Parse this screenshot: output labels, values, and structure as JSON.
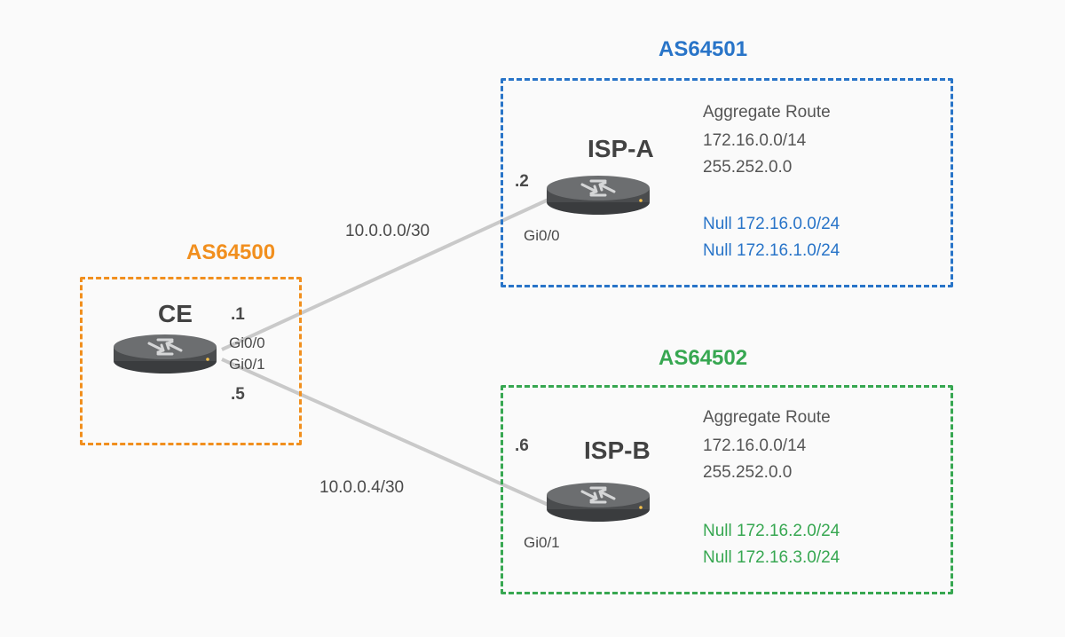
{
  "as": {
    "ce": {
      "title": "AS64500",
      "router_name": "CE",
      "ip1": ".1",
      "iface1": "Gi0/0",
      "iface2": "Gi0/1",
      "ip2": ".5"
    },
    "ispa": {
      "title": "AS64501",
      "router_name": "ISP-A",
      "ip": ".2",
      "iface": "Gi0/0",
      "agg_title": "Aggregate Route",
      "agg_net": "172.16.0.0/14",
      "agg_mask": "255.252.0.0",
      "null1": "Null 172.16.0.0/24",
      "null2": "Null 172.16.1.0/24"
    },
    "ispb": {
      "title": "AS64502",
      "router_name": "ISP-B",
      "ip": ".6",
      "iface": "Gi0/1",
      "agg_title": "Aggregate Route",
      "agg_net": "172.16.0.0/14",
      "agg_mask": "255.252.0.0",
      "null1": "Null 172.16.2.0/24",
      "null2": "Null 172.16.3.0/24"
    }
  },
  "links": {
    "a": "10.0.0.0/30",
    "b": "10.0.0.4/30"
  },
  "colors": {
    "orange": "#f18f1e",
    "blue": "#2874c8",
    "green": "#37a751",
    "gray": "#c9c9c9",
    "router_top": "#6c6e70",
    "router_side": "#4a4c4e",
    "text": "#4a4a4a"
  }
}
